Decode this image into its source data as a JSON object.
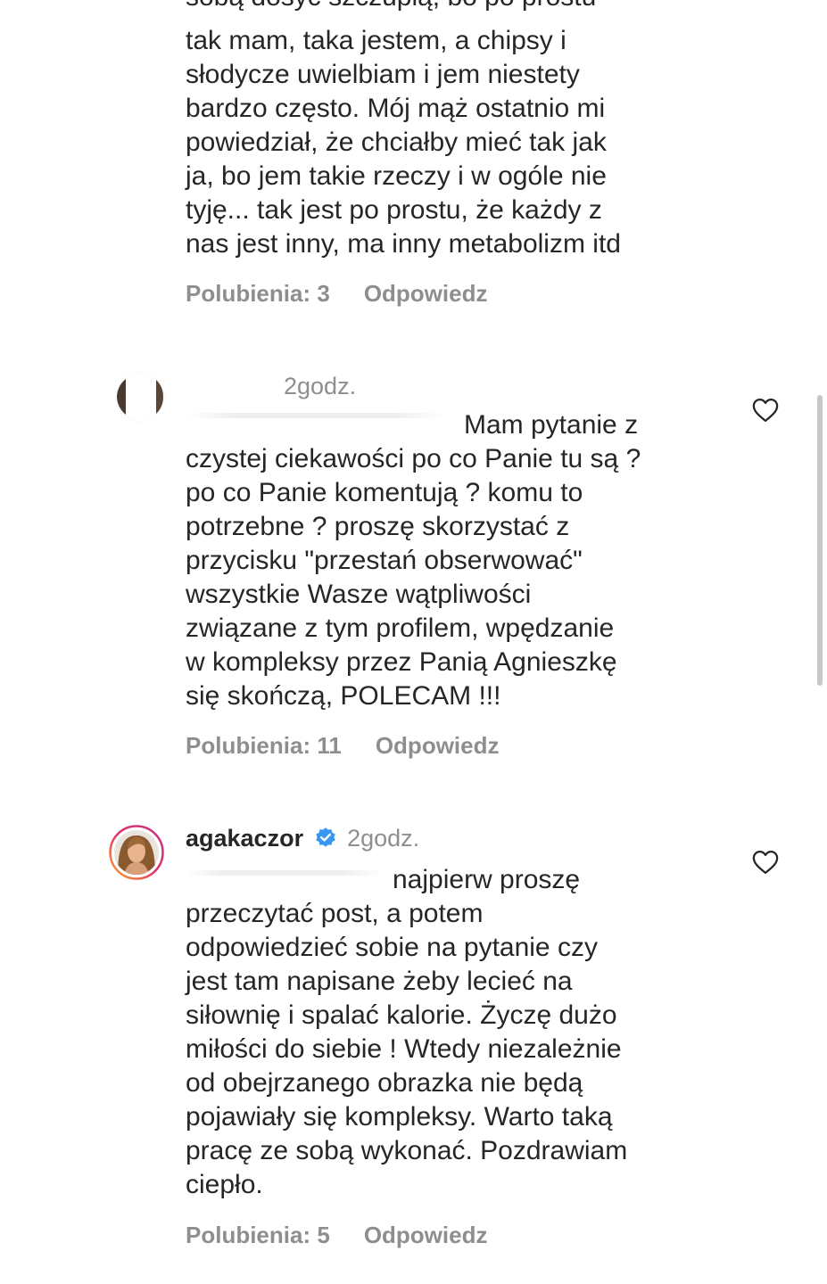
{
  "comments": [
    {
      "text_cut_top": "sobą dosyć szczupłą, bo po prostu",
      "text": "tak mam, taka jestem, a chipsy i\nsłodycze uwielbiam i jem niestety\nbardzo często. Mój mąż ostatnio mi\npowiedział, że chciałby mieć tak jak\nja, bo jem takie rzeczy i w ogóle nie\ntyję... tak jest po prostu, że każdy z\nnas jest inny, ma inny metabolizm itd",
      "likes_label": "Polubienia: 3",
      "reply_label": "Odpowiedz"
    },
    {
      "time": "2godz.",
      "text_first": "Mam pytanie  z",
      "text": "czystej ciekawości po co Panie tu są ?\npo co Panie komentują ? komu to\npotrzebne ? proszę skorzystać z\nprzycisku \"przestań obserwować\"\nwszystkie Wasze wątpliwości\nzwiązane z tym profilem, wpędzanie\nw kompleksy przez Panią Agnieszkę\nsię skończą, POLECAM !!!",
      "likes_label": "Polubienia: 11",
      "reply_label": "Odpowiedz",
      "like_icon": "heart-outline-icon"
    },
    {
      "username": "agakaczor",
      "verified_icon": "verified-badge-icon",
      "time": "2godz.",
      "text_first": "najpierw proszę",
      "text": "przeczytać post, a potem\nodpowiedzieć sobie na pytanie czy\njest tam napisane żeby lecieć na\nsiłownię i spalać kalorie. Życzę dużo\nmiłości do siebie ! Wtedy niezależnie\nod obejrzanego obrazka nie będą\npojawiały się kompleksy. Warto taką\npracę ze sobą wykonać. Pozdrawiam\nciepło.",
      "likes_label": "Polubienia: 5",
      "reply_label": "Odpowiedz",
      "like_icon": "heart-outline-icon"
    }
  ],
  "colors": {
    "text": "#262626",
    "secondary": "#8e8e8e",
    "verified": "#3897f0",
    "story_ring_start": "#f9a825",
    "story_ring_end": "#c13584"
  }
}
